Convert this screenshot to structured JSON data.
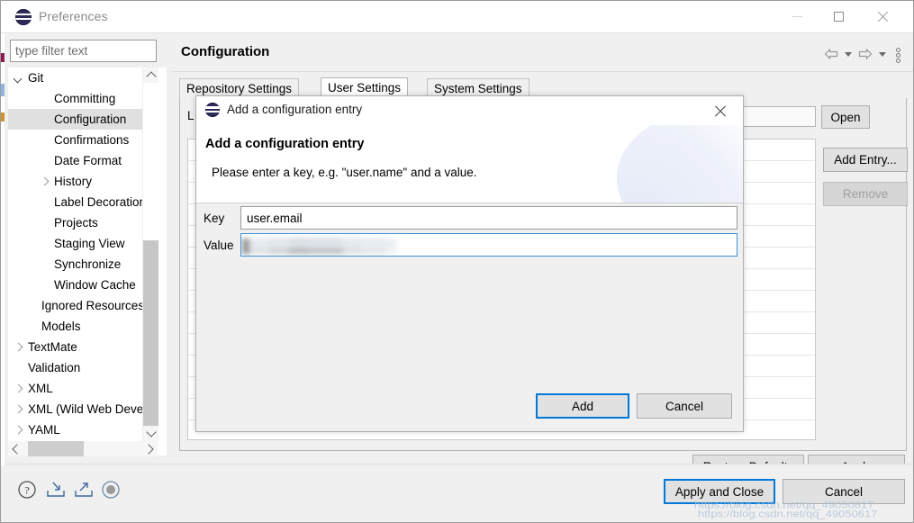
{
  "window": {
    "title": "Preferences",
    "app_icon": "eclipse-logo-icon",
    "controls": {
      "minimize": "–",
      "maximize": "□",
      "close": "✕"
    }
  },
  "sidebar": {
    "filter": {
      "value": "",
      "placeholder": "type filter text"
    },
    "items": [
      {
        "label": "Git",
        "indent": 22,
        "twisty": "down",
        "selected": false
      },
      {
        "label": "Committing",
        "indent": 51,
        "twisty": "none",
        "selected": false
      },
      {
        "label": "Configuration",
        "indent": 51,
        "twisty": "none",
        "selected": true
      },
      {
        "label": "Confirmations",
        "indent": 51,
        "twisty": "none",
        "selected": false
      },
      {
        "label": "Date Format",
        "indent": 51,
        "twisty": "none",
        "selected": false
      },
      {
        "label": "History",
        "indent": 51,
        "twisty": "right",
        "selected": false
      },
      {
        "label": "Label Decorations",
        "indent": 51,
        "twisty": "none",
        "selected": false
      },
      {
        "label": "Projects",
        "indent": 51,
        "twisty": "none",
        "selected": false
      },
      {
        "label": "Staging View",
        "indent": 51,
        "twisty": "none",
        "selected": false
      },
      {
        "label": "Synchronize",
        "indent": 51,
        "twisty": "none",
        "selected": false
      },
      {
        "label": "Window Cache",
        "indent": 51,
        "twisty": "none",
        "selected": false
      },
      {
        "label": "Ignored Resources",
        "indent": 37,
        "twisty": "none",
        "selected": false
      },
      {
        "label": "Models",
        "indent": 37,
        "twisty": "none",
        "selected": false
      },
      {
        "label": "TextMate",
        "indent": 22,
        "twisty": "right",
        "selected": false
      },
      {
        "label": "Validation",
        "indent": 22,
        "twisty": "none",
        "selected": false
      },
      {
        "label": "XML",
        "indent": 22,
        "twisty": "right",
        "selected": false
      },
      {
        "label": "XML (Wild Web Developer)",
        "indent": 22,
        "twisty": "right",
        "selected": false
      },
      {
        "label": "YAML",
        "indent": 22,
        "twisty": "right",
        "selected": false
      }
    ]
  },
  "content": {
    "page_title": "Configuration",
    "nav": {
      "back_icon": "back-arrow-icon",
      "back_menu_icon": "chevron-down-icon",
      "forward_icon": "forward-arrow-icon",
      "forward_menu_icon": "chevron-down-icon",
      "menu_icon": "vertical-dots-icon"
    },
    "tabs": [
      {
        "label": "Repository Settings",
        "active": false
      },
      {
        "label": "User Settings",
        "active": true
      },
      {
        "label": "System Settings",
        "active": false
      }
    ],
    "location": {
      "label": "L",
      "value": ""
    },
    "open_label": "Open",
    "add_entry_label": "Add Entry...",
    "remove_label": "Remove",
    "remove_enabled": false,
    "table_rows": 13,
    "restore_defaults_label": "Restore Defaults",
    "apply_label": "Apply"
  },
  "bottom_bar": {
    "icons": [
      {
        "name": "help-icon"
      },
      {
        "name": "import-icon"
      },
      {
        "name": "export-icon"
      },
      {
        "name": "status-circle-icon"
      }
    ],
    "apply_and_close_label": "Apply and Close",
    "cancel_label": "Cancel"
  },
  "dialog": {
    "title": "Add a configuration entry",
    "icon": "eclipse-logo-icon",
    "close_icon": "close-icon",
    "heading": "Add a configuration entry",
    "subtitle": "Please enter a key, e.g. \"user.name\" and a value.",
    "key_label": "Key",
    "key_value": "user.email",
    "value_label": "Value",
    "value_value": "",
    "value_redacted": true,
    "add_label": "Add",
    "cancel_label": "Cancel",
    "add_focused": true
  },
  "watermark": {
    "line1": "https://blog.csdn.net/qq_49050617",
    "line2": "https://blog.csdn.net/qq_49050617"
  },
  "colors": {
    "accent": "#0078d7",
    "window_bg": "#f0f0f0",
    "selection": "#e0e0e0",
    "eclipse_purple": "#2c2a58"
  }
}
